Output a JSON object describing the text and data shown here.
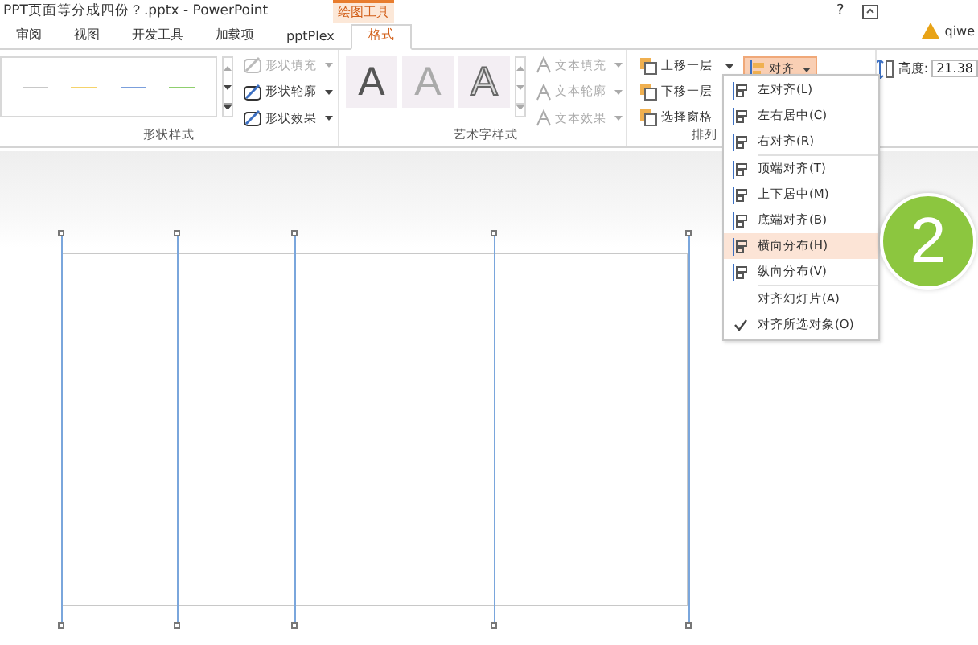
{
  "window": {
    "title": "PPT页面等分成四份？.pptx - PowerPoint",
    "context_tab": "绘图工具",
    "help": "?",
    "user": "qiwe"
  },
  "tabs": [
    {
      "label": "审阅",
      "selected": false
    },
    {
      "label": "视图",
      "selected": false
    },
    {
      "label": "开发工具",
      "selected": false
    },
    {
      "label": "加载项",
      "selected": false
    },
    {
      "label": "pptPlex",
      "selected": false
    },
    {
      "label": "格式",
      "selected": true
    }
  ],
  "shape_styles": {
    "label": "形状样式",
    "swatches": [
      {
        "color": "#c8c8c8"
      },
      {
        "color": "#f5d36b"
      },
      {
        "color": "#7b9fdc"
      },
      {
        "color": "#8fcf6e"
      }
    ],
    "commands": [
      {
        "label": "形状填充",
        "disabled": true
      },
      {
        "label": "形状轮廓",
        "disabled": false
      },
      {
        "label": "形状效果",
        "disabled": false
      }
    ]
  },
  "wordart_styles": {
    "label": "艺术字样式",
    "samples": [
      "A",
      "A",
      "A"
    ],
    "commands": [
      {
        "label": "文本填充",
        "disabled": true
      },
      {
        "label": "文本轮廓",
        "disabled": true
      },
      {
        "label": "文本效果",
        "disabled": true
      }
    ]
  },
  "arrange": {
    "label": "排列",
    "commands": [
      {
        "label": "上移一层"
      },
      {
        "label": "下移一层"
      },
      {
        "label": "选择窗格"
      }
    ],
    "align": {
      "label": "对齐",
      "expanded": true
    }
  },
  "size": {
    "height_label": "高度:",
    "height_value": "21.38"
  },
  "align_menu": [
    {
      "label": "左对齐(L)",
      "highlighted": false,
      "checked": false,
      "icon": true,
      "separator_after": false
    },
    {
      "label": "左右居中(C)",
      "highlighted": false,
      "checked": false,
      "icon": true,
      "separator_after": false
    },
    {
      "label": "右对齐(R)",
      "highlighted": false,
      "checked": false,
      "icon": true,
      "separator_after": true
    },
    {
      "label": "顶端对齐(T)",
      "highlighted": false,
      "checked": false,
      "icon": true,
      "separator_after": false
    },
    {
      "label": "上下居中(M)",
      "highlighted": false,
      "checked": false,
      "icon": true,
      "separator_after": false
    },
    {
      "label": "底端对齐(B)",
      "highlighted": false,
      "checked": false,
      "icon": true,
      "separator_after": false
    },
    {
      "label": "横向分布(H)",
      "highlighted": true,
      "checked": false,
      "icon": true,
      "separator_after": false
    },
    {
      "label": "纵向分布(V)",
      "highlighted": false,
      "checked": false,
      "icon": true,
      "separator_after": true
    },
    {
      "label": "对齐幻灯片(A)",
      "highlighted": false,
      "checked": false,
      "icon": false,
      "separator_after": false
    },
    {
      "label": "对齐所选对象(O)",
      "highlighted": false,
      "checked": true,
      "icon": false,
      "separator_after": false
    }
  ],
  "step_badge": "2"
}
